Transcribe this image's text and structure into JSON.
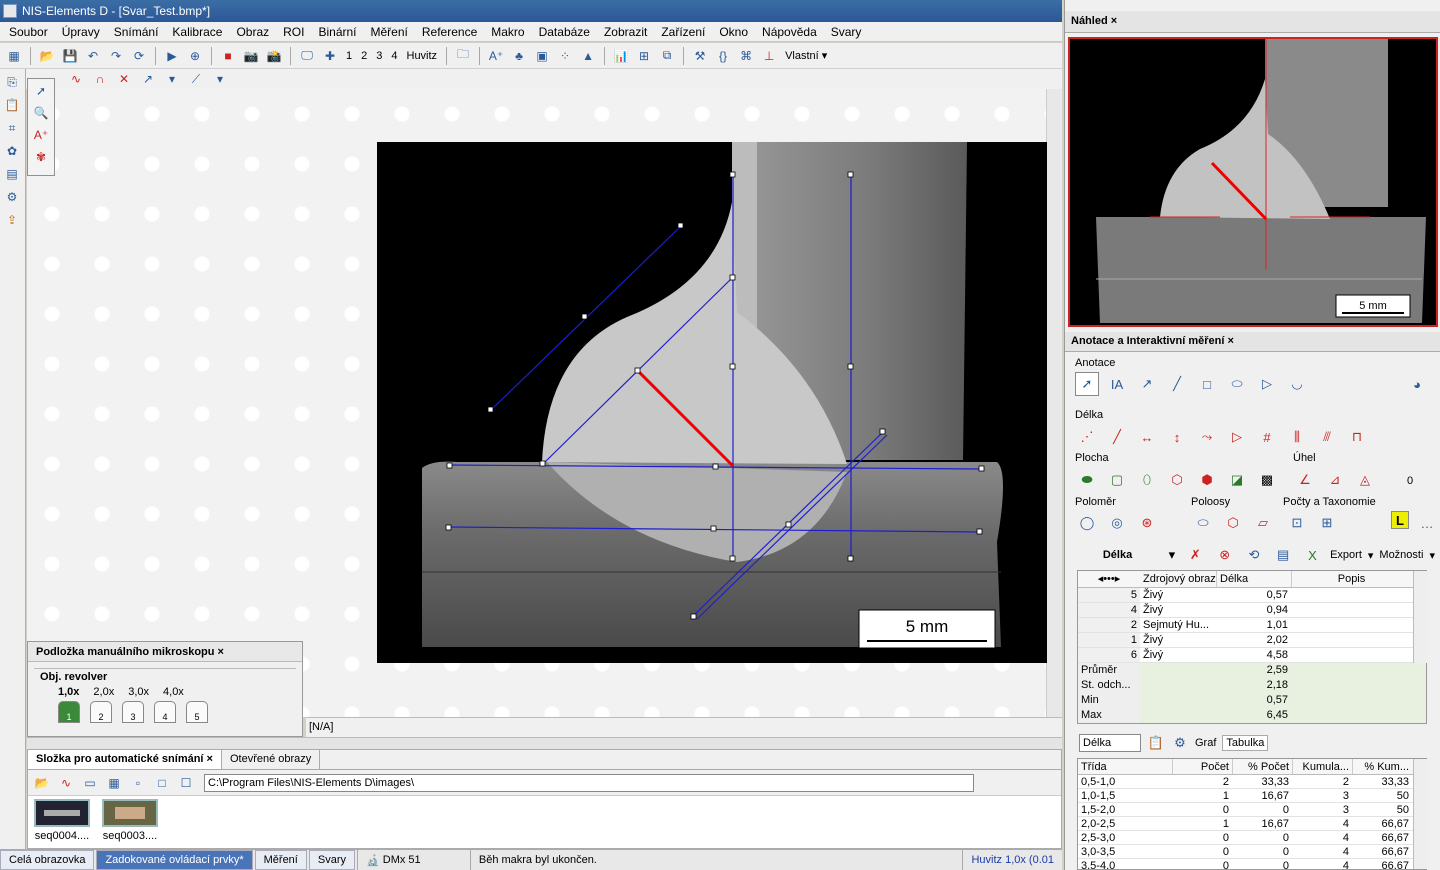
{
  "window": {
    "title": "NIS-Elements D - [Svar_Test.bmp*]"
  },
  "menu": [
    "Soubor",
    "Úpravy",
    "Snímání",
    "Kalibrace",
    "Obraz",
    "ROI",
    "Binární",
    "Měření",
    "Reference",
    "Makro",
    "Databáze",
    "Zobrazit",
    "Zařízení",
    "Okno",
    "Nápověda",
    "Svary"
  ],
  "toolbar": {
    "layers": [
      "1",
      "2",
      "3",
      "4"
    ],
    "huvitz": "Huvitz",
    "vlastni": "Vlastní ▾"
  },
  "image": {
    "scale_label": "5 mm"
  },
  "image_status": "[N/A]",
  "microscope": {
    "title": "Podložka manuálního mikroskopu",
    "group": "Obj. revolver",
    "mags": [
      "1,0x",
      "2,0x",
      "3,0x",
      "4,0x"
    ],
    "positions": [
      "1",
      "2",
      "3",
      "4",
      "5"
    ]
  },
  "bottom": {
    "tabs": [
      "Složka pro automatické snímání",
      "Otevřené obrazy"
    ],
    "path": "C:\\Program Files\\NIS-Elements D\\images\\",
    "thumbs": [
      "seq0004....",
      "seq0003...."
    ]
  },
  "statusbar": {
    "tabs": [
      "Celá obrazovka",
      "Zadokované ovládací prvky*",
      "Měření",
      "Svary"
    ],
    "device": "DMx 51",
    "message": "Běh makra byl ukončen.",
    "zoom": "Huvitz 1,0x (0.01"
  },
  "preview": {
    "title": "Náhled",
    "scale_label": "5 mm"
  },
  "anno": {
    "title": "Anotace a Interaktivní měření",
    "sections": {
      "anotace": "Anotace",
      "delka": "Délka",
      "plocha": "Plocha",
      "uhel": "Úhel",
      "polomer": "Poloměr",
      "poloosy": "Poloosy",
      "pocty": "Počty a Taxonomie"
    },
    "angle_value": "0",
    "measure_type": "Délka",
    "export": "Export",
    "moznosti": "Možnosti",
    "columns": [
      "Zdrojový obraz",
      "Délka",
      "Popis"
    ],
    "rows": [
      {
        "id": "5",
        "src": "Živý",
        "len": "0,57"
      },
      {
        "id": "4",
        "src": "Živý",
        "len": "0,94"
      },
      {
        "id": "2",
        "src": "Sejmutý Hu...",
        "len": "1,01"
      },
      {
        "id": "1",
        "src": "Živý",
        "len": "2,02"
      },
      {
        "id": "6",
        "src": "Živý",
        "len": "4,58"
      }
    ],
    "stats": [
      {
        "label": "Průměr",
        "value": "2,59"
      },
      {
        "label": "St. odch...",
        "value": "2,18"
      },
      {
        "label": "Min",
        "value": "0,57"
      },
      {
        "label": "Max",
        "value": "6,45"
      }
    ],
    "hist_select": "Délka",
    "hist_tabs": [
      "Graf",
      "Tabulka"
    ],
    "hist_columns": [
      "Třída",
      "Počet",
      "% Počet",
      "Kumula...",
      "% Kum..."
    ],
    "hist_rows": [
      [
        "0,5-1,0",
        "2",
        "33,33",
        "2",
        "33,33"
      ],
      [
        "1,0-1,5",
        "1",
        "16,67",
        "3",
        "50"
      ],
      [
        "1,5-2,0",
        "0",
        "0",
        "3",
        "50"
      ],
      [
        "2,0-2,5",
        "1",
        "16,67",
        "4",
        "66,67"
      ],
      [
        "2,5-3,0",
        "0",
        "0",
        "4",
        "66,67"
      ],
      [
        "3,0-3,5",
        "0",
        "0",
        "4",
        "66,67"
      ],
      [
        "3,5-4,0",
        "0",
        "0",
        "4",
        "66,67"
      ]
    ]
  }
}
